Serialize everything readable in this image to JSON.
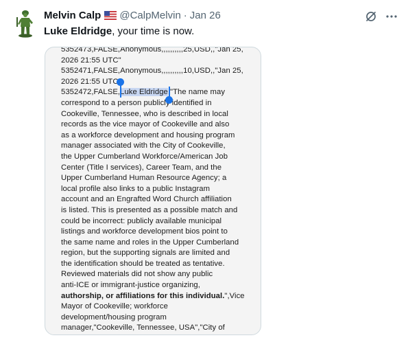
{
  "tweet": {
    "author": {
      "name": "Melvin Calp",
      "handle": "@CalpMelvin",
      "separator": "·",
      "date": "Jan 26",
      "flag_icon": "us-flag-icon",
      "avatar_icon": "toy-soldier-avatar"
    },
    "actions": {
      "grok_icon": "grok-icon",
      "more_icon": "more-icon"
    },
    "text": {
      "mention": "Luke Eldridge",
      "rest": ", your time is now."
    },
    "document": {
      "line_00": "5352473,FALSE,Anonymous,,,,,,,,,,25,USD,,\"Jan 25,",
      "line_01": "2026 21:55 UTC\"",
      "line_02": "5352471,FALSE,Anonymous,,,,,,,,,,10,USD,,\"Jan 25,",
      "line_03": "2026 21:55 UTC\"",
      "line_04_pre": "5352472,FALSE,",
      "line_04_sel": "Luke Eldridge",
      "line_04_post": ",\"The name may",
      "line_05": "correspond to a person publicly identified in",
      "line_06": "Cookeville, Tennessee, who is described in local",
      "line_07": "records as the vice mayor of Cookeville and also",
      "line_08": "as a workforce development and housing program",
      "line_09": "manager associated with the City of Cookeville,",
      "line_10": "the Upper Cumberland Workforce/American Job",
      "line_11": "Center (Title I services), Career Team, and the",
      "line_12": "Upper Cumberland Human Resource Agency; a",
      "line_13": "local profile also links to a public Instagram",
      "line_14": "account and an Engrafted Word Church affiliation",
      "line_15": "is listed. This is presented as a possible match and",
      "line_16": "could be incorrect: publicly available municipal",
      "line_17": "listings and workforce development bios point to",
      "line_18": "the same name and roles in the Upper Cumberland",
      "line_19": "region, but the supporting signals are limited and",
      "line_20": "the identification should be treated as tentative.",
      "line_21": "Reviewed materials did not show any public",
      "line_22": "anti-ICE or immigrant-justice organizing,",
      "line_23_bold": "authorship, or affiliations for this individual.",
      "line_23_post": "\",Vice",
      "line_24": "Mayor of Cookeville; workforce",
      "line_25": "development/housing program",
      "line_26": "manager,\"Cookeville, Tennessee, USA\",\"City of"
    }
  },
  "colors": {
    "text": "#0f1419",
    "secondary": "#536471",
    "border": "#cfd9de",
    "selection": "#c8d7f2",
    "selection_handle": "#1a73e8",
    "media_bg": "#f4f4f4"
  }
}
